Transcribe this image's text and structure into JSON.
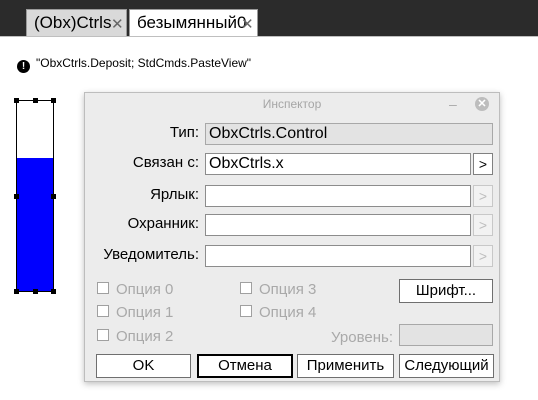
{
  "tabs": [
    {
      "label": "(Obx)Ctrls"
    },
    {
      "label": "безымянный0"
    }
  ],
  "command": {
    "text": "\"ObxCtrls.Deposit; StdCmds.PasteView\""
  },
  "gauge": {
    "level": 0.7
  },
  "inspector": {
    "title": "Инспектор",
    "fields": {
      "type": {
        "label": "Тип:",
        "value": "ObxCtrls.Control"
      },
      "link": {
        "label": "Связан с:",
        "value": "ObxCtrls.x"
      },
      "label": {
        "label": "Ярлык:",
        "value": ""
      },
      "guard": {
        "label": "Охранник:",
        "value": ""
      },
      "notifier": {
        "label": "Уведомитель:",
        "value": ""
      }
    },
    "arrow_glyph": ">",
    "options": [
      "Опция 0",
      "Опция 1",
      "Опция 2",
      "Опция 3",
      "Опция 4"
    ],
    "font_button": "Шрифт...",
    "level": {
      "label": "Уровень:",
      "value": ""
    },
    "buttons": {
      "ok": "OK",
      "cancel": "Отмена",
      "apply": "Применить",
      "next": "Следующий"
    }
  }
}
